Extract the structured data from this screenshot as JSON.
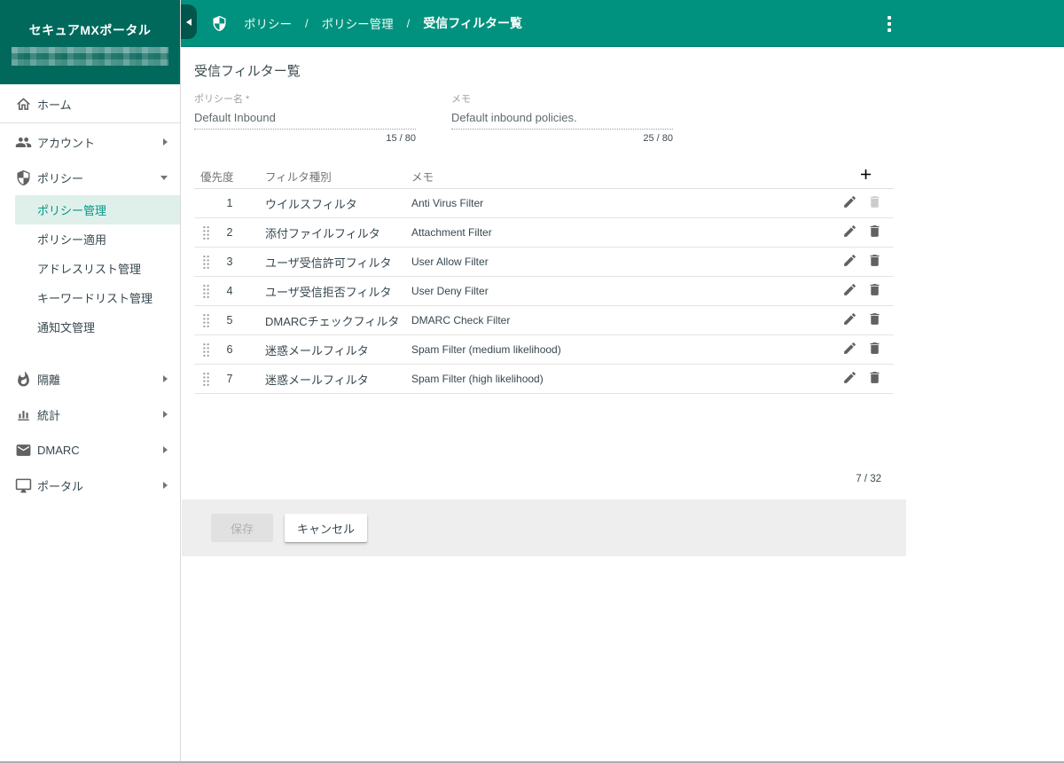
{
  "app": {
    "title": "セキュアMXポータル",
    "account_masked": true
  },
  "appbar": {
    "breadcrumb": [
      "ポリシー",
      "ポリシー管理",
      "受信フィルター覧"
    ]
  },
  "sidebar": {
    "items": [
      {
        "id": "home",
        "label": "ホーム",
        "icon": "home-icon",
        "divider_after": true
      },
      {
        "id": "accounts",
        "label": "アカウント",
        "icon": "accounts-icon",
        "expandable": true
      },
      {
        "id": "policy",
        "label": "ポリシー",
        "icon": "policy-shield-icon",
        "expandable": true,
        "expanded": true,
        "children": [
          {
            "id": "policy-management",
            "label": "ポリシー管理",
            "selected": true
          },
          {
            "id": "policy-apply",
            "label": "ポリシー適用"
          },
          {
            "id": "address-list-management",
            "label": "アドレスリスト管理"
          },
          {
            "id": "keyword-list-management",
            "label": "キーワードリスト管理"
          },
          {
            "id": "notification-management",
            "label": "通知文管理"
          }
        ]
      },
      {
        "id": "quarantine",
        "label": "隔離",
        "icon": "quarantine-flame-icon",
        "expandable": true,
        "group_gap": true
      },
      {
        "id": "stats",
        "label": "統計",
        "icon": "stats-chart-icon",
        "expandable": true
      },
      {
        "id": "dmarc",
        "label": "DMARC",
        "icon": "mail-icon",
        "expandable": true
      },
      {
        "id": "portal",
        "label": "ポータル",
        "icon": "portal-monitor-icon",
        "expandable": true
      }
    ]
  },
  "page": {
    "title": "受信フィルター覧",
    "fields": [
      {
        "label": "ポリシー名 *",
        "value": "Default Inbound",
        "counter": "15 / 80"
      },
      {
        "label": "メモ",
        "value": "Default inbound policies.",
        "counter": "25 / 80"
      }
    ],
    "table": {
      "columns": [
        "優先度",
        "フィルタ種別",
        "メモ"
      ],
      "rows": [
        {
          "priority": "1",
          "type": "ウイルスフィルタ",
          "memo": "Anti Virus Filter",
          "draggable": false,
          "deletable": false
        },
        {
          "priority": "2",
          "type": "添付ファイルフィルタ",
          "memo": "Attachment Filter",
          "draggable": true,
          "deletable": true
        },
        {
          "priority": "3",
          "type": "ユーザ受信許可フィルタ",
          "memo": "User Allow Filter",
          "draggable": true,
          "deletable": true
        },
        {
          "priority": "4",
          "type": "ユーザ受信拒否フィルタ",
          "memo": "User Deny Filter",
          "draggable": true,
          "deletable": true
        },
        {
          "priority": "5",
          "type": "DMARCチェックフィルタ",
          "memo": "DMARC Check Filter",
          "draggable": true,
          "deletable": true
        },
        {
          "priority": "6",
          "type": "迷惑メールフィルタ",
          "memo": "Spam Filter (medium likelihood)",
          "draggable": true,
          "deletable": true
        },
        {
          "priority": "7",
          "type": "迷惑メールフィルタ",
          "memo": "Spam Filter (high likelihood)",
          "draggable": true,
          "deletable": true
        }
      ],
      "total": "7 / 32"
    },
    "actions": {
      "save": "保存",
      "save_disabled": true,
      "cancel": "キャンセル"
    }
  },
  "colors": {
    "appbar": "#00927E",
    "sidebar_header": "#00695C",
    "collapse_tab": "#00564A",
    "selected_item_bg": "#DFF0EB",
    "accent": "#009884"
  }
}
